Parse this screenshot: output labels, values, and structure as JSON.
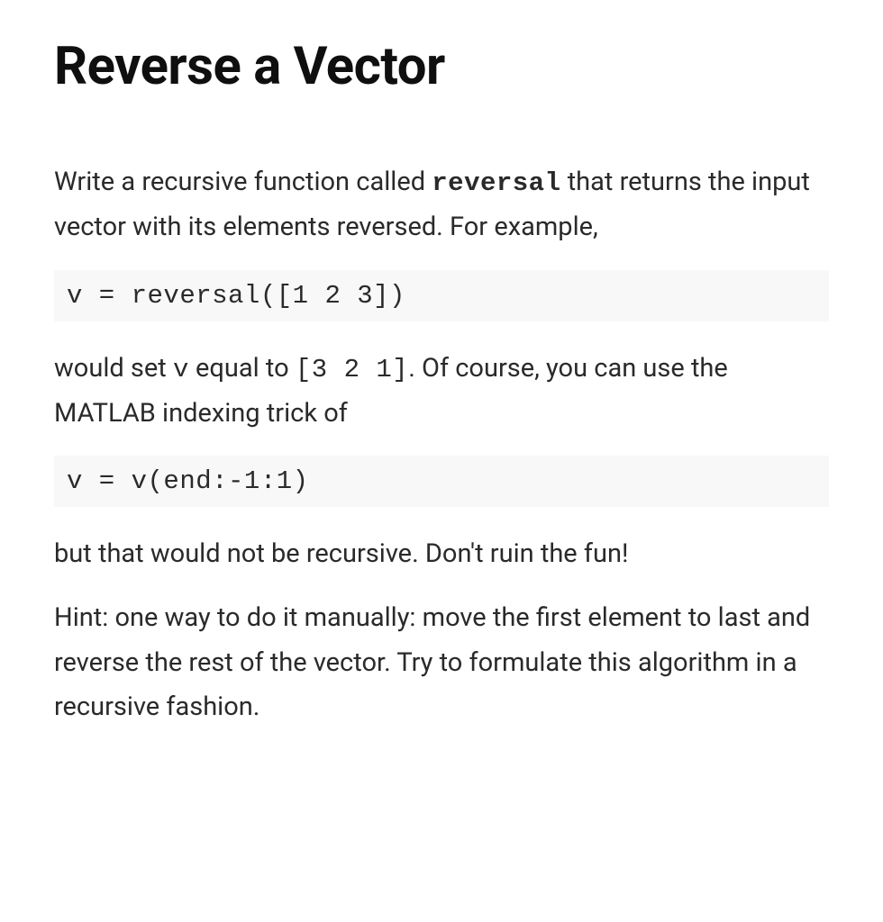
{
  "title": "Reverse a Vector",
  "p1_a": "Write a recursive function called ",
  "p1_func": "reversal",
  "p1_b": " that returns the input vector with its elements reversed.  For example,",
  "code1": "v = reversal([1 2 3])",
  "p2_a": " would set ",
  "p2_v": "v",
  "p2_b": "  equal to ",
  "p2_arr": "[3 2 1]",
  "p2_c": ". Of course, you can use the MATLAB indexing trick of",
  "code2": "v = v(end:-1:1)",
  "p3": " but that would not be recursive. Don't ruin the fun!",
  "p4": "Hint: one way to do it manually: move the first element to last and reverse the rest of the vector. Try to formulate this algorithm in a recursive fashion."
}
